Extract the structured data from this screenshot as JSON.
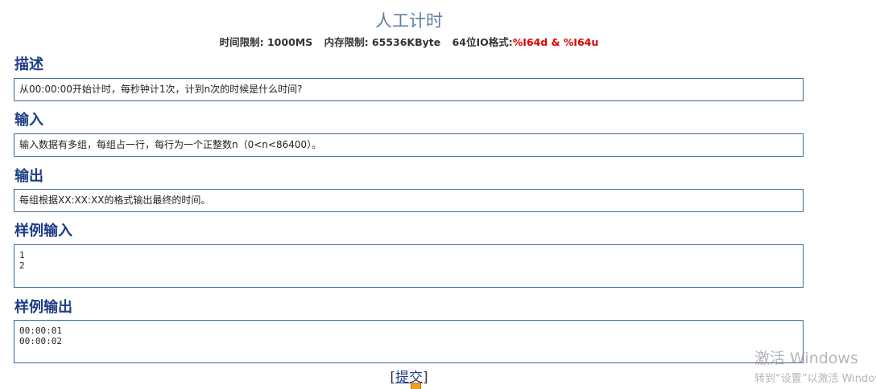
{
  "problem": {
    "title": "人工计时",
    "limits": {
      "time": "时间限制: 1000MS",
      "memory": "内存限制: 65536KByte",
      "io_label": "64位IO格式:",
      "io_format": "%I64d & %I64u"
    }
  },
  "sections": {
    "description": {
      "heading": "描述",
      "text": "从00:00:00开始计时，每秒钟计1次，计到n次的时候是什么时间?"
    },
    "input": {
      "heading": "输入",
      "text": "输入数据有多组，每组占一行，每行为一个正整数n（0<n<86400）。"
    },
    "output": {
      "heading": "输出",
      "text": "每组根据XX:XX:XX的格式输出最终的时间。"
    },
    "sample_input": {
      "heading": "样例输入",
      "lines": [
        "1",
        "2"
      ]
    },
    "sample_output": {
      "heading": "样例输出",
      "lines": [
        "00:00:01",
        "00:00:02"
      ]
    }
  },
  "actions": {
    "bracket_open": "[",
    "submit_label": "提交",
    "bracket_close": "]"
  },
  "watermark": {
    "line1": "激活 Windows",
    "line2": "转到“设置”以激活 Windows。"
  }
}
